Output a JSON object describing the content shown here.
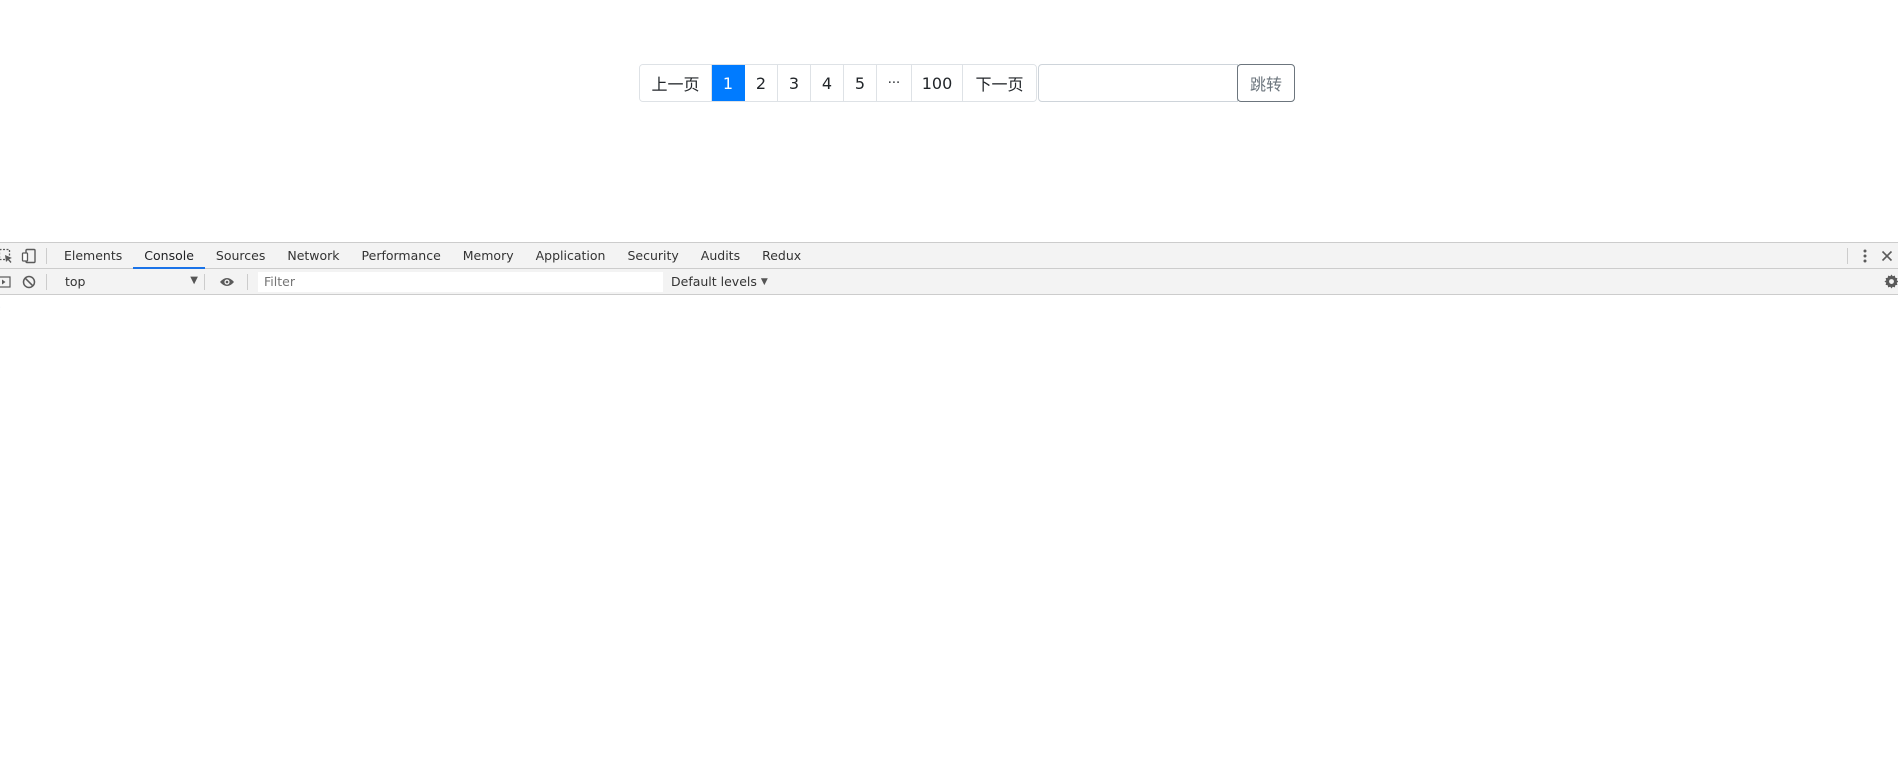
{
  "pagination": {
    "prev_label": "上一页",
    "pages": [
      "1",
      "2",
      "3",
      "4",
      "5"
    ],
    "active_page": "1",
    "ellipsis": "···",
    "last_page": "100",
    "next_label": "下一页",
    "jump_input_value": "",
    "jump_button_label": "跳转"
  },
  "devtools": {
    "tabs": [
      "Elements",
      "Console",
      "Sources",
      "Network",
      "Performance",
      "Memory",
      "Application",
      "Security",
      "Audits",
      "Redux"
    ],
    "active_tab": "Console",
    "toolbar": {
      "context": "top",
      "filter_placeholder": "Filter",
      "levels_label": "Default levels"
    },
    "prompt": "›"
  },
  "colors": {
    "active_page_bg": "#007bff",
    "active_tab_underline": "#1a73e8"
  }
}
